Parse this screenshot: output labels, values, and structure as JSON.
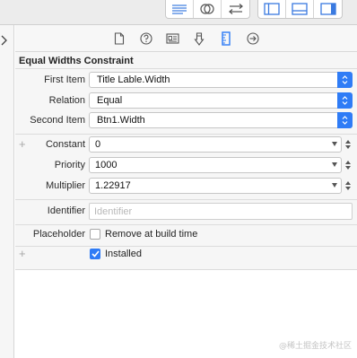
{
  "toolbar": {
    "group1": [
      "editor-standard-icon",
      "editor-assistant-icon",
      "editor-version-icon"
    ],
    "group2": [
      "navigator-toggle-icon",
      "debug-area-toggle-icon",
      "utilities-toggle-icon"
    ]
  },
  "tabs": [
    {
      "name": "file-inspector-icon"
    },
    {
      "name": "quick-help-icon"
    },
    {
      "name": "identity-inspector-icon"
    },
    {
      "name": "attributes-inspector-icon"
    },
    {
      "name": "size-inspector-icon",
      "active": true
    },
    {
      "name": "connections-inspector-icon"
    }
  ],
  "constraint": {
    "title": "Equal Widths Constraint",
    "first_item_label": "First Item",
    "first_item_value": "Title Lable.Width",
    "relation_label": "Relation",
    "relation_value": "Equal",
    "second_item_label": "Second Item",
    "second_item_value": "Btn1.Width",
    "constant_label": "Constant",
    "constant_value": "0",
    "priority_label": "Priority",
    "priority_value": "1000",
    "multiplier_label": "Multiplier",
    "multiplier_value": "1.22917",
    "identifier_label": "Identifier",
    "identifier_placeholder": "Identifier",
    "placeholder_label": "Placeholder",
    "remove_at_build_label": "Remove at build time",
    "remove_at_build_checked": false,
    "installed_label": "Installed",
    "installed_checked": true
  },
  "watermark": "@稀土掘金技术社区",
  "colors": {
    "accent": "#2f7cf6",
    "toolbar_icon": "#3a7ae0"
  }
}
